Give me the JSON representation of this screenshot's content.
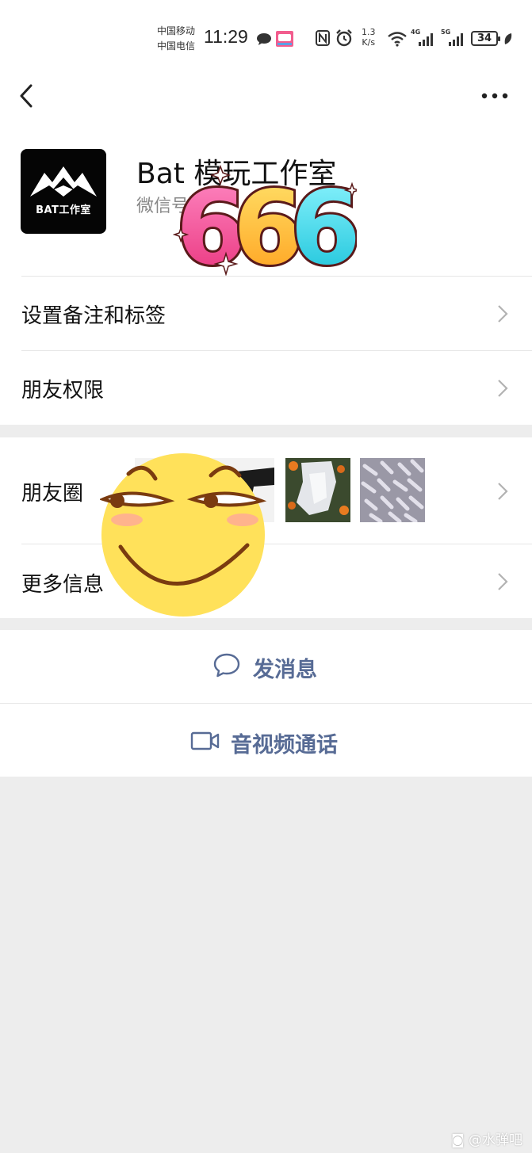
{
  "status_bar": {
    "carrier_1": "中国移动",
    "carrier_2": "中国电信",
    "time": "11:29",
    "speed_value": "1.3",
    "speed_unit": "K/s",
    "net_1": "4G",
    "net_2": "5G",
    "battery": "34"
  },
  "profile": {
    "avatar_text": "BAT工作室",
    "name": "Bat 模玩工作室",
    "wechat_id_prefix": "微信号"
  },
  "sticker": {
    "text": "666"
  },
  "menu": {
    "remarks_tags": "设置备注和标签",
    "friend_permissions": "朋友权限",
    "moments": "朋友圈",
    "more_info": "更多信息"
  },
  "actions": {
    "send_message": "发消息",
    "video_call": "音视频通话"
  },
  "watermark": "@水弹吧",
  "colors": {
    "link_blue": "#576b95",
    "background": "#ededed"
  }
}
